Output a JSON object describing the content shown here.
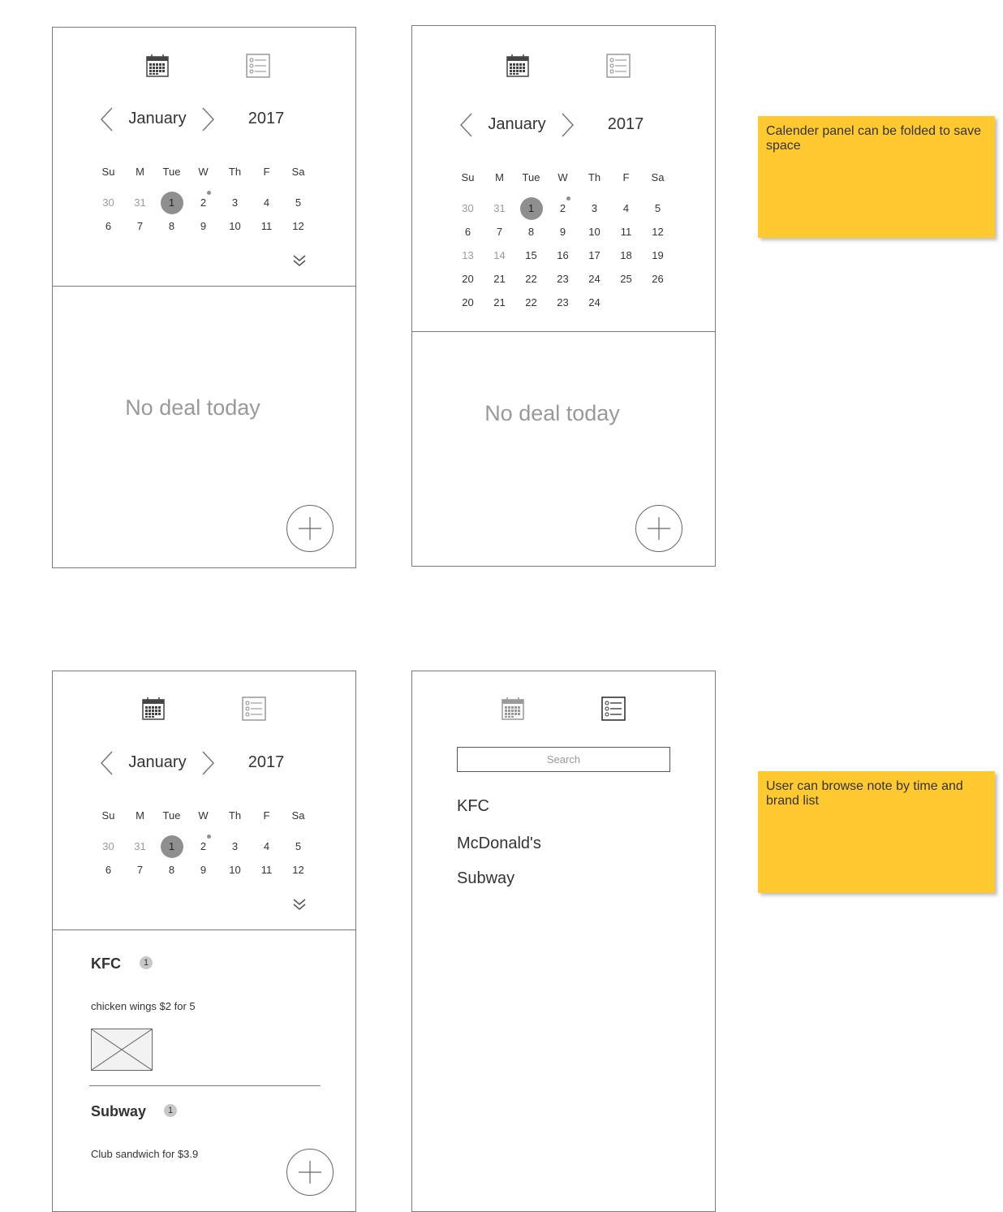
{
  "calendar": {
    "month": "January",
    "year": "2017",
    "weekdays": [
      "Su",
      "M",
      "Tue",
      "W",
      "Th",
      "F",
      "Sa"
    ],
    "collapsed_weeks": [
      [
        "30",
        "31",
        "1",
        "2",
        "3",
        "4",
        "5"
      ],
      [
        "6",
        "7",
        "8",
        "9",
        "10",
        "11",
        "12"
      ]
    ],
    "expanded_weeks": [
      [
        "30",
        "31",
        "1",
        "2",
        "3",
        "4",
        "5"
      ],
      [
        "6",
        "7",
        "8",
        "9",
        "10",
        "11",
        "12"
      ],
      [
        "13",
        "14",
        "15",
        "16",
        "17",
        "18",
        "19"
      ],
      [
        "20",
        "21",
        "22",
        "23",
        "24",
        "25",
        "26"
      ],
      [
        "20",
        "21",
        "22",
        "23",
        "24",
        "",
        ""
      ]
    ]
  },
  "empty_state": {
    "message": "No deal today"
  },
  "deals": [
    {
      "brand": "KFC",
      "count": "1",
      "description": "chicken wings $2 for 5",
      "has_image": true
    },
    {
      "brand": "Subway",
      "count": "1",
      "description": "Club sandwich for  $3.9",
      "has_image": false
    }
  ],
  "brand_list": {
    "search_placeholder": "Search",
    "brands": [
      "KFC",
      "McDonald's",
      "Subway"
    ]
  },
  "notes": {
    "fold_note": "Calender panel can be folded to save space",
    "browse_note": "User can browse note by time and brand list"
  },
  "colors": {
    "sticky_note": "#ffc92f",
    "selected_day": "#8f8f8f",
    "border": "#7a7a7a"
  },
  "icons": {
    "calendar_tab": "calendar-icon",
    "list_tab": "list-icon",
    "prev": "chevron-left-icon",
    "next": "chevron-right-icon",
    "fold": "double-chevron-down-icon",
    "add": "plus-icon",
    "image": "image-placeholder-icon"
  }
}
